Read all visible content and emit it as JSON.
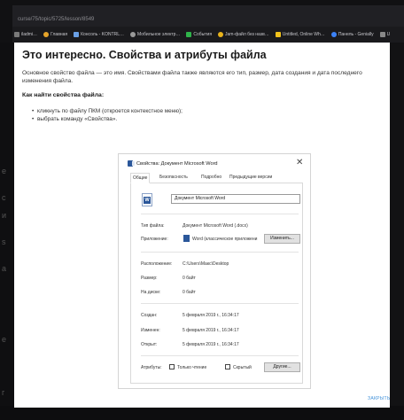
{
  "browser": {
    "url": "curse/75/topic/5725/lesson/8549",
    "bookmarks": [
      {
        "label": "iladmi…",
        "icon": "pin-icon",
        "color": "#7a7a7a"
      },
      {
        "label": "Главная",
        "icon": "home-icon",
        "color": "#e6a42a"
      },
      {
        "label": "Консоль - KONTRL…",
        "icon": "console-icon",
        "color": "#6aa0e6"
      },
      {
        "label": "Мобильное электр…",
        "icon": "mobile-icon",
        "color": "#999999"
      },
      {
        "label": "События",
        "icon": "events-icon",
        "color": "#2fb34a"
      },
      {
        "label": "Jam-файл без назв…",
        "icon": "file-icon",
        "color": "#e8b31b"
      },
      {
        "label": "Untitled, Online Wh…",
        "icon": "whiteboard-icon",
        "color": "#f1c21b"
      },
      {
        "label": "Панель - Genially",
        "icon": "genially-icon",
        "color": "#3c82f6"
      },
      {
        "label": "U",
        "icon": "bookmark-icon",
        "color": "#888888"
      }
    ],
    "side_letters": [
      "е",
      "с",
      "и",
      "s",
      "а",
      "е",
      "г"
    ]
  },
  "modal": {
    "title": "Это интересно. Свойства и атрибуты файла",
    "paragraph": "Основное свойство файла — это имя. Свойствами файла также являются его тип, размер, дата создания и дата последнего изменения файла.",
    "heading": "Как найти свойства файла:",
    "steps": [
      "кликнуть по файлу ПКМ (откроется контекстное меню);",
      "выбрать команду «Свойства»."
    ],
    "close_label": "ЗАКРЫТЬ"
  },
  "dialog": {
    "title": "Свойства: Документ Microsoft Word",
    "close_glyph": "✕",
    "tabs": [
      "Общие",
      "Безопасность",
      "Подробно",
      "Предыдущие версии"
    ],
    "active_tab": "Общие",
    "file_name": "Документ Microsoft Word",
    "rows": {
      "type_label": "Тип файла:",
      "type_value": "Документ Microsoft Word (.docx)",
      "app_label": "Приложение:",
      "app_value": "Word (классическое приложени",
      "change_button": "Изменить...",
      "location_label": "Расположение:",
      "location_value": "C:\\Users\\Макс\\Desktop",
      "size_label": "Размер:",
      "size_value": "0 байт",
      "disk_label": "На диске:",
      "disk_value": "0 байт",
      "created_label": "Создан:",
      "created_value": "5 февраля 2019 г., 16:34:17",
      "modified_label": "Изменен:",
      "modified_value": "5 февраля 2019 г., 16:34:17",
      "opened_label": "Открыт:",
      "opened_value": "5 февраля 2019 г., 16:34:17",
      "attributes_label": "Атрибуты:",
      "readonly_label": "Только чтение",
      "hidden_label": "Скрытый",
      "other_button": "Другие..."
    }
  },
  "colors": {
    "accent_link": "#3d8fd9",
    "word_blue": "#2b579a"
  }
}
